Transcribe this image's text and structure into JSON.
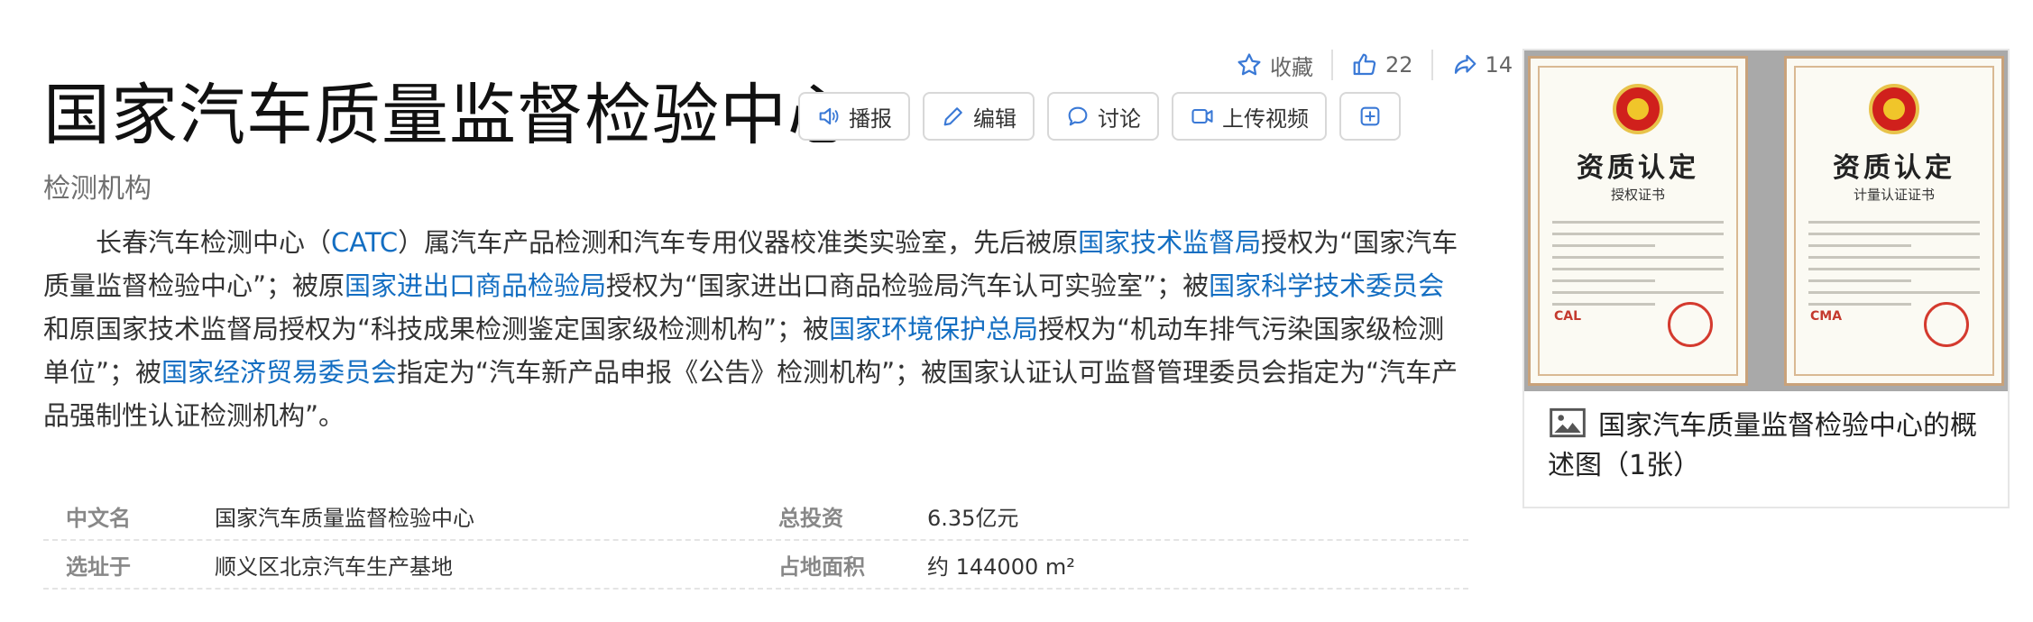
{
  "actions": {
    "favorite": "收藏",
    "like_count": "22",
    "share_count": "14"
  },
  "title": "国家汽车质量监督检验中心",
  "toolbar": {
    "play": "播报",
    "edit": "编辑",
    "discuss": "讨论",
    "upload_video": "上传视频"
  },
  "subtitle": "检测机构",
  "summary": {
    "s1": "长春汽车检测中心（",
    "l1": "CATC",
    "s2": "）属汽车产品检测和汽车专用仪器校准类实验室，先后被原",
    "l2": "国家技术监督局",
    "s3": "授权为“国家汽车质量监督检验中心”；被原",
    "l3": "国家进出口商品检验局",
    "s4": "授权为“国家进出口商品检验局汽车认可实验室”；被",
    "l4": "国家科学技术委员会",
    "s5": "和原国家技术监督局授权为“科技成果检测鉴定国家级检测机构”；被",
    "l5": "国家环境保护总局",
    "s6": "授权为“机动车排气污染国家级检测单位”；被",
    "l6": "国家经济贸易委员会",
    "s7": "指定为“汽车新产品申报《公告》检测机构”；被国家认证认可监督管理委员会指定为“汽车产品强制性认证检测机构”。"
  },
  "info": {
    "rows": [
      {
        "k1": "中文名",
        "v1": "国家汽车质量监督检验中心",
        "k2": "总投资",
        "v2": "6.35亿元"
      },
      {
        "k1": "选址于",
        "v1": "顺义区北京汽车生产基地",
        "k2": "占地面积",
        "v2": "约 144000 m²"
      }
    ]
  },
  "album": {
    "cert_left": {
      "title": "资质认定",
      "subtitle": "授权证书",
      "mark": "CAL"
    },
    "cert_right": {
      "title": "资质认定",
      "subtitle": "计量认证证书",
      "mark": "CMA"
    },
    "caption": "国家汽车质量监督检验中心的概述图（1张）"
  },
  "colors": {
    "link": "#136ec2",
    "accent": "#3a79d6"
  }
}
